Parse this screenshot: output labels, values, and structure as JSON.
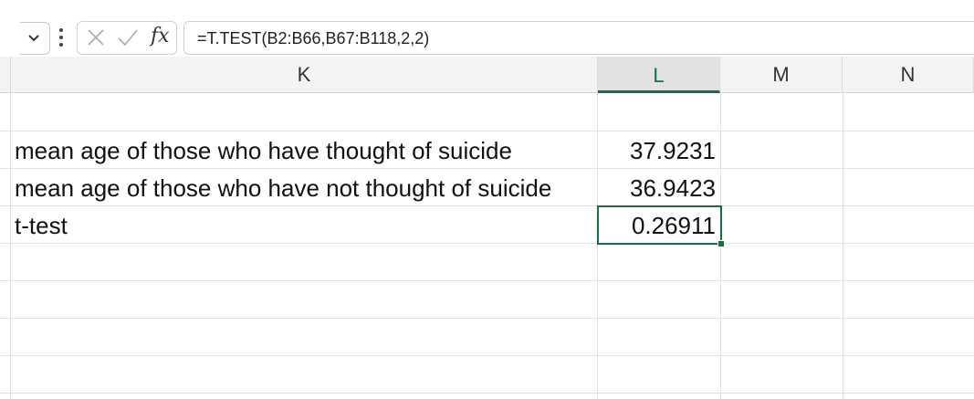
{
  "formula_bar": {
    "formula": "=T.TEST(B2:B66,B67:B118,2,2)",
    "fx_label": "fx",
    "cancel_icon": "close-icon",
    "enter_icon": "check-icon"
  },
  "columns": [
    "K",
    "L",
    "M",
    "N"
  ],
  "selected_column": "L",
  "rows": [
    {
      "label": "mean age of those who have thought of suicide",
      "value": "37.9231"
    },
    {
      "label": "mean age of those who have not thought of suicide",
      "value": "36.9423"
    },
    {
      "label": "t-test",
      "value": "0.26911"
    }
  ],
  "colors": {
    "accent": "#1e6b41",
    "gridline": "#e1e1e1",
    "header_bg": "#f3f3f3"
  }
}
